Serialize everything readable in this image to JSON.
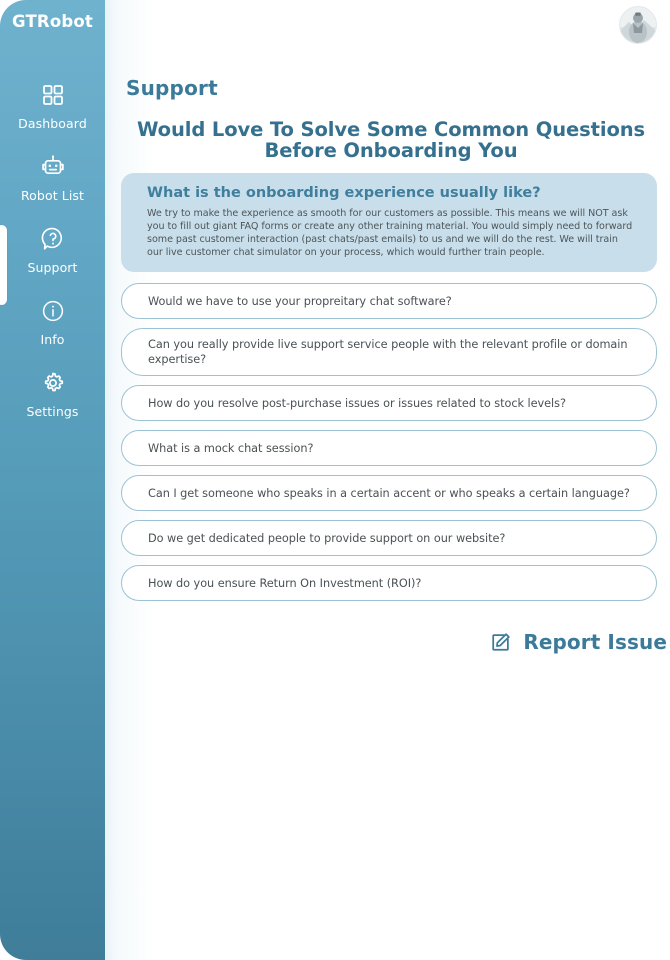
{
  "brand": {
    "name": "GTRobot"
  },
  "colors": {
    "sidebar_top": "#6fb2ce",
    "sidebar_bottom": "#3f7d99",
    "accent": "#3b7a99",
    "panel_bg": "#c8dfeb",
    "card_border": "#9cc3d4",
    "body_text": "#4a5154"
  },
  "sidebar": {
    "items": [
      {
        "label": "Dashboard",
        "icon": "grid-icon",
        "active": false
      },
      {
        "label": "Robot List",
        "icon": "robot-icon",
        "active": false
      },
      {
        "label": "Support",
        "icon": "question-bubble-icon",
        "active": true
      },
      {
        "label": "Info",
        "icon": "info-circle-icon",
        "active": false
      },
      {
        "label": "Settings",
        "icon": "gear-icon",
        "active": false
      }
    ]
  },
  "header": {
    "avatar_icon": "user-avatar"
  },
  "main": {
    "page_title": "Support",
    "headline": "Would Love To Solve Some Common Questions Before Onboarding You",
    "report": {
      "label": "Report Issue",
      "icon": "edit-square-icon"
    }
  },
  "faq": {
    "open": {
      "question": "What is the onboarding experience usually like?",
      "answer": "We try to make the experience as smooth for our customers as possible. This means we will NOT ask you to fill out giant FAQ forms or create any other training material. You would simply need to forward some past customer interaction (past chats/past emails) to us and we will do the rest. We will train our live customer chat simulator on your process, which would further train people."
    },
    "items": [
      {
        "question": "Would we have to use your propreitary chat software?"
      },
      {
        "question": "Can you really provide live support service people with the relevant profile or domain expertise?"
      },
      {
        "question": "How do you resolve post-purchase issues or issues related to stock levels?"
      },
      {
        "question": "What is a mock chat session?"
      },
      {
        "question": "Can I get someone who speaks in a certain accent or who speaks a certain language?"
      },
      {
        "question": "Do we get dedicated people to provide support on our website?"
      },
      {
        "question": "How do you ensure Return On Investment (ROI)?"
      }
    ]
  }
}
